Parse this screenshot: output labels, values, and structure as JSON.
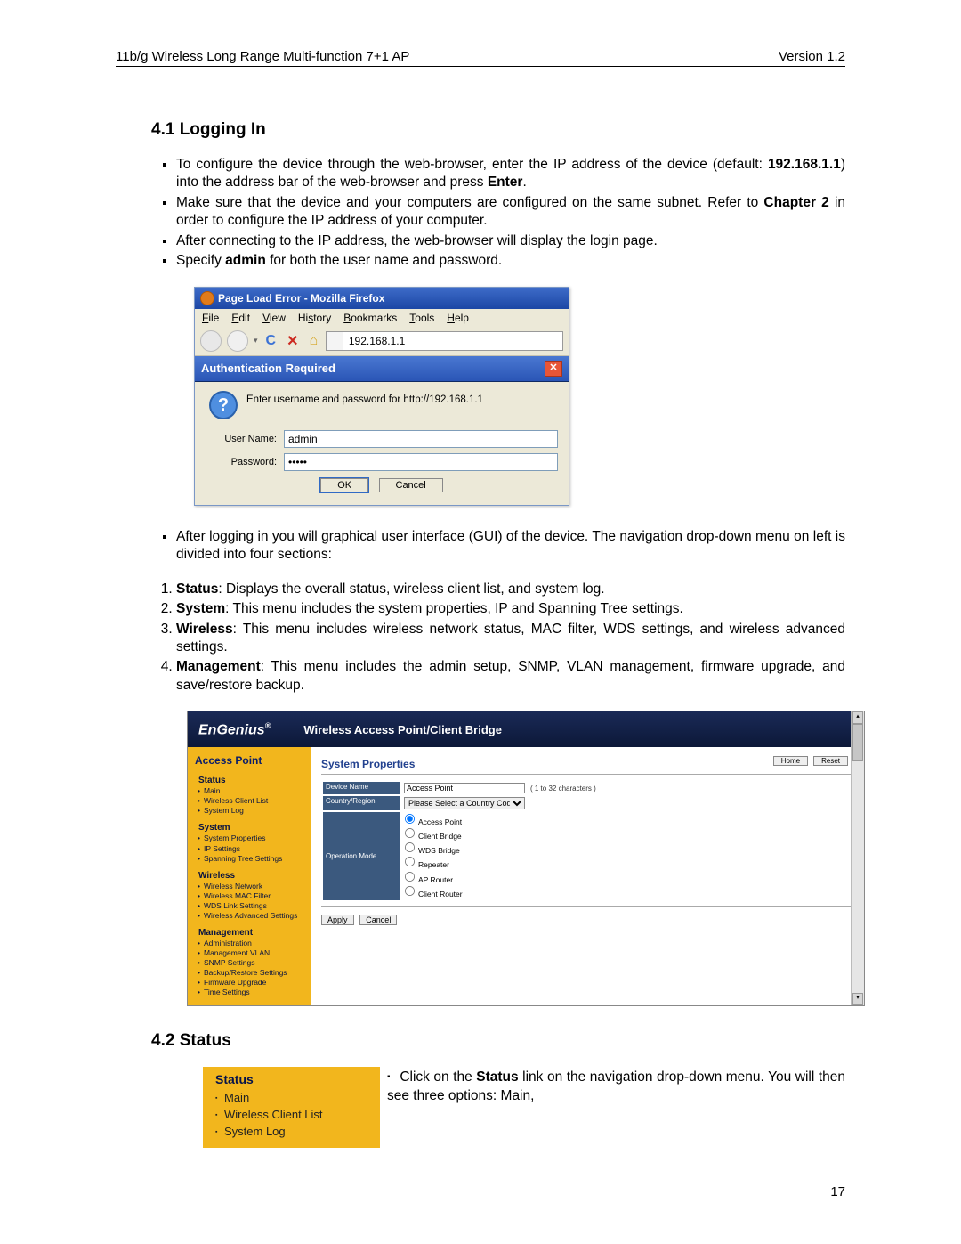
{
  "header": {
    "left": "11b/g Wireless Long Range Multi-function 7+1 AP",
    "right": "Version 1.2"
  },
  "section41": {
    "title": "4.1 Logging In",
    "bullets_top": {
      "b1_pre": "To configure the device through the web-browser, enter the IP address of the device (default: ",
      "b1_ip": "192.168.1.1",
      "b1_mid": ") into the address bar of the web-browser and press ",
      "b1_enter": "Enter",
      "b1_post": ".",
      "b2_pre": "Make sure that the device and your computers are configured on the same subnet. Refer to ",
      "b2_ch": "Chapter 2",
      "b2_post": " in order to configure the IP address of your computer.",
      "b3": "After connecting to the IP address, the web-browser will display the login page.",
      "b4_pre": "Specify ",
      "b4_admin": "admin",
      "b4_post": " for both the user name and password."
    },
    "bullets_after": {
      "a1": "After logging in you will graphical user interface (GUI) of the device. The navigation drop-down menu on left is divided into four sections:"
    },
    "numlist": {
      "n1_b": "Status",
      "n1_t": ": Displays the overall status, wireless client list, and system log.",
      "n2_b": "System",
      "n2_t": ": This menu includes the system properties, IP and Spanning Tree settings.",
      "n3_b": "Wireless",
      "n3_t": ": This menu includes wireless network status, MAC filter, WDS settings, and wireless advanced settings.",
      "n4_b": "Management",
      "n4_t": ": This menu includes the admin setup, SNMP, VLAN management, firmware upgrade, and save/restore backup."
    }
  },
  "firefox": {
    "title": "Page Load Error - Mozilla Firefox",
    "menus": [
      "File",
      "Edit",
      "View",
      "History",
      "Bookmarks",
      "Tools",
      "Help"
    ],
    "url": "192.168.1.1",
    "auth_title": "Authentication Required",
    "auth_msg": "Enter username and password for http://192.168.1.1",
    "labels": {
      "user": "User Name:",
      "pass": "Password:"
    },
    "values": {
      "user": "admin",
      "pass": "•••••"
    },
    "buttons": {
      "ok": "OK",
      "cancel": "Cancel"
    }
  },
  "engenius": {
    "logo": "EnGenius",
    "slogan": "Wireless Access Point/Client Bridge",
    "side_title": "Access Point",
    "nav": {
      "status": {
        "h": "Status",
        "items": [
          "Main",
          "Wireless Client List",
          "System Log"
        ]
      },
      "system": {
        "h": "System",
        "items": [
          "System Properties",
          "IP Settings",
          "Spanning Tree Settings"
        ]
      },
      "wireless": {
        "h": "Wireless",
        "items": [
          "Wireless Network",
          "Wireless MAC Filter",
          "WDS Link Settings",
          "Wireless Advanced Settings"
        ]
      },
      "management": {
        "h": "Management",
        "items": [
          "Administration",
          "Management VLAN",
          "SNMP Settings",
          "Backup/Restore Settings",
          "Firmware Upgrade",
          "Time Settings"
        ]
      }
    },
    "panel": {
      "title": "System Properties",
      "btn_home": "Home",
      "btn_reset": "Reset",
      "rows": {
        "devname_l": "Device Name",
        "devname_v": "Access Point",
        "devname_hint": "( 1 to 32 characters )",
        "country_l": "Country/Region",
        "country_v": "Please Select a Country Code",
        "opmode_l": "Operation Mode",
        "modes": [
          "Access Point",
          "Client Bridge",
          "WDS Bridge",
          "Repeater",
          "AP Router",
          "Client Router"
        ]
      },
      "apply": "Apply",
      "cancel": "Cancel"
    }
  },
  "section42": {
    "title": "4.2 Status",
    "menu": {
      "h": "Status",
      "items": [
        "Main",
        "Wireless Client List",
        "System Log"
      ]
    },
    "para_pre": "Click on the ",
    "para_b": "Status",
    "para_post": " link on the navigation drop-down menu. You will then see three options: Main,"
  },
  "footer": {
    "page": "17"
  }
}
